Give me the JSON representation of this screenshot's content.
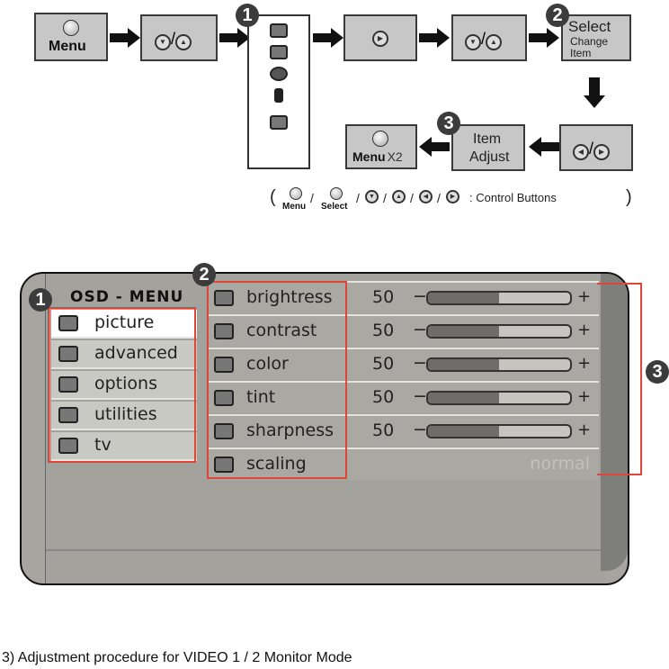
{
  "flow": {
    "step1": {
      "label": "Menu",
      "icon": "menu-button-icon"
    },
    "step2": {
      "icons": [
        "down-button-icon",
        "up-button-icon"
      ],
      "sep": "/"
    },
    "step3": {
      "badge": "1",
      "icons": [
        "picture-icon",
        "advanced-icon",
        "options-icon",
        "utilities-icon",
        "tv-icon"
      ]
    },
    "step4": {
      "icon": "right-button-icon"
    },
    "step5": {
      "icons": [
        "down-button-icon",
        "up-button-icon"
      ],
      "sep": "/"
    },
    "step6": {
      "badge": "2",
      "title": "Select",
      "line2": "Change",
      "line3": "Item"
    },
    "step7": {
      "icons": [
        "left-button-icon",
        "right-button-icon"
      ],
      "sep": "/"
    },
    "step8": {
      "badge": "3",
      "line1": "Item",
      "line2": "Adjust"
    },
    "step9": {
      "label": "Menu",
      "suffix": "X2"
    }
  },
  "legend": {
    "open": "(",
    "menu_label": "Menu",
    "select_label": "Select",
    "sep": "/",
    "suffix": ": Control Buttons",
    "close": ")"
  },
  "osd": {
    "title": "OSD - MENU",
    "badges": [
      "1",
      "2",
      "3"
    ],
    "categories": [
      {
        "label": "picture",
        "icon": "picture-icon",
        "selected": true
      },
      {
        "label": "advanced",
        "icon": "advanced-icon",
        "selected": false
      },
      {
        "label": "options",
        "icon": "options-icon",
        "selected": false
      },
      {
        "label": "utilities",
        "icon": "utilities-icon",
        "selected": false
      },
      {
        "label": "tv",
        "icon": "tv-icon",
        "selected": false
      }
    ],
    "items": [
      {
        "label": "brightress",
        "icon": "brightness-icon",
        "value": "50",
        "level": 0.5
      },
      {
        "label": "contrast",
        "icon": "contrast-icon",
        "value": "50",
        "level": 0.5
      },
      {
        "label": "color",
        "icon": "color-icon",
        "value": "50",
        "level": 0.5
      },
      {
        "label": "tint",
        "icon": "tint-icon",
        "value": "50",
        "level": 0.5
      },
      {
        "label": "sharpness",
        "icon": "sharpness-icon",
        "value": "50",
        "level": 0.5
      },
      {
        "label": "scaling",
        "icon": "scaling-icon",
        "setting": "normal"
      }
    ],
    "minus": "−",
    "plus": "+"
  },
  "caption": "3) Adjustment procedure for VIDEO 1 / 2 Monitor Mode",
  "colors": {
    "highlight": "#e0453a",
    "panel": "#a6a5a0",
    "box": "#c7c7c7"
  }
}
